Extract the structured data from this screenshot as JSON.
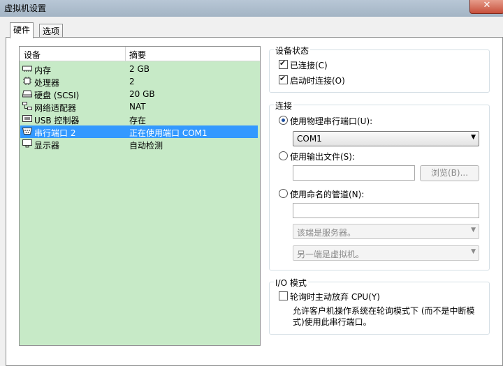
{
  "window": {
    "title": "虚拟机设置",
    "close_label": "✕"
  },
  "tabs": [
    {
      "label": "硬件"
    },
    {
      "label": "选项"
    }
  ],
  "device_list": {
    "col_device": "设备",
    "col_summary": "摘要",
    "rows": [
      {
        "name": "内存",
        "summary": "2 GB",
        "icon": "memory-icon"
      },
      {
        "name": "处理器",
        "summary": "2",
        "icon": "processor-icon"
      },
      {
        "name": "硬盘 (SCSI)",
        "summary": "20 GB",
        "icon": "harddisk-icon"
      },
      {
        "name": "网络适配器",
        "summary": "NAT",
        "icon": "network-icon"
      },
      {
        "name": "USB 控制器",
        "summary": "存在",
        "icon": "usb-icon"
      },
      {
        "name": "串行端口 2",
        "summary": "正在使用端口 COM1",
        "icon": "serial-port-icon",
        "selected": true
      },
      {
        "name": "显示器",
        "summary": "自动检测",
        "icon": "display-icon"
      }
    ]
  },
  "device_status": {
    "legend": "设备状态",
    "connected_label": "已连接(C)",
    "connected_checked": true,
    "connect_on_power_label": "启动时连接(O)",
    "connect_on_power_checked": true
  },
  "connection": {
    "legend": "连接",
    "physical_label": "使用物理串行端口(U):",
    "physical_value": "COM1",
    "output_file_label": "使用输出文件(S):",
    "browse_label": "浏览(B)...",
    "named_pipe_label": "使用命名的管道(N):",
    "pipe_this_end": "该端是服务器。",
    "pipe_other_end": "另一端是虚拟机。",
    "selected_mode": "physical"
  },
  "io_mode": {
    "legend": "I/O 模式",
    "yield_cpu_label": "轮询时主动放弃 CPU(Y)",
    "yield_cpu_checked": false,
    "description_line1": "允许客户机操作系统在轮询模式下 (而不是中断模",
    "description_line2": "式)使用此串行端口。"
  },
  "colors": {
    "selection": "#3399ff",
    "list_background": "#c7eac7",
    "accent": "#1f4f9e"
  }
}
